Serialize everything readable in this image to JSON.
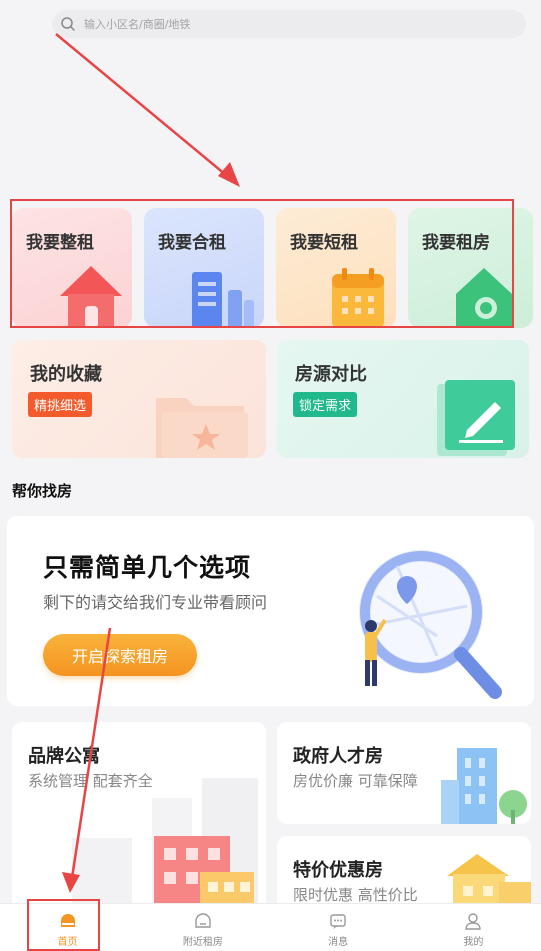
{
  "search": {
    "placeholder": "输入小区名/商圈/地铁",
    "icon": "search-icon"
  },
  "categories": [
    {
      "label": "我要整租",
      "icon": "house-icon"
    },
    {
      "label": "我要合租",
      "icon": "buildings-icon"
    },
    {
      "label": "我要短租",
      "icon": "calendar-icon"
    },
    {
      "label": "我要租房",
      "icon": "house-search-icon"
    }
  ],
  "favorites": {
    "title": "我的收藏",
    "tag": "精挑细选",
    "icon": "folder-star-icon"
  },
  "compare": {
    "title": "房源对比",
    "tag": "锁定需求",
    "icon": "edit-doc-icon"
  },
  "section": {
    "title": "帮你找房"
  },
  "help": {
    "title": "只需简单几个选项",
    "subtitle": "剩下的请交给我们专业带看顾问",
    "button": "开启探索租房"
  },
  "brand_apartment": {
    "title": "品牌公寓",
    "subtitle": "系统管理 配套齐全"
  },
  "gov_talent": {
    "title": "政府人才房",
    "subtitle": "房优价廉 可靠保障"
  },
  "special_offer": {
    "title": "特价优惠房",
    "subtitle": "限时优惠 高性价比"
  },
  "tabs": [
    {
      "label": "首页",
      "icon": "home-icon",
      "active": true
    },
    {
      "label": "附近租房",
      "icon": "nearby-icon",
      "active": false
    },
    {
      "label": "消息",
      "icon": "message-icon",
      "active": false
    },
    {
      "label": "我的",
      "icon": "profile-icon",
      "active": false
    }
  ],
  "colors": {
    "accent": "#f49421",
    "annotation": "#e84545",
    "green": "#20b98d",
    "orange_tag": "#f35a2c"
  }
}
